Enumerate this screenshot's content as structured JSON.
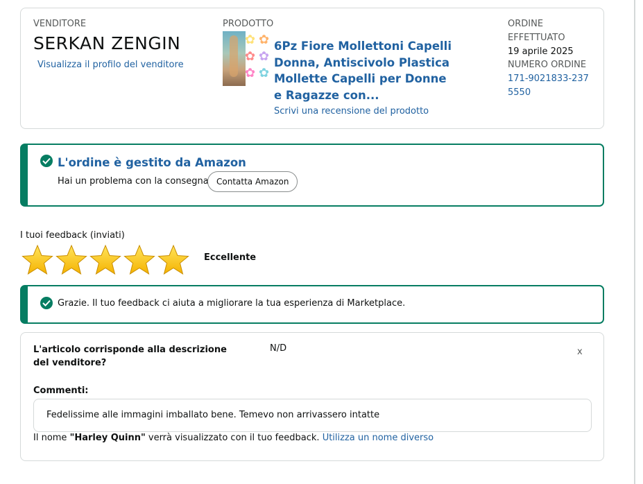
{
  "seller": {
    "label": "VENDITORE",
    "name": "SERKAN ZENGIN",
    "profile_link": "Visualizza il profilo del venditore"
  },
  "product": {
    "label": "PRODOTTO",
    "title": "6Pz Fiore Mollettoni Capelli Donna, Antiscivolo Plastica Mollette Capelli per Donne e Ragazze con...",
    "review_link": "Scrivi una recensione del prodotto"
  },
  "order": {
    "placed_label": "ORDINE EFFETTUATO",
    "placed_date": "19 aprile 2025",
    "number_label": "NUMERO ORDINE",
    "number": "171-9021833-2375550"
  },
  "fulfillment_alert": {
    "heading": "L'ordine è gestito da Amazon",
    "text": "Hai un problema con la consegna?",
    "button": "Contatta Amazon"
  },
  "feedback": {
    "label": "I tuoi feedback (inviati)",
    "rating": 5,
    "max_rating": 5,
    "rating_text": "Eccellente",
    "star_color": "#f5b301"
  },
  "thanks_alert": {
    "text": "Grazie. Il tuo feedback ci aiuta a migliorare la tua esperienza di Marketplace."
  },
  "details": {
    "question": "L'articolo corrisponde alla descrizione del venditore?",
    "answer": "N/D",
    "close": "x",
    "comments_label": "Commenti:",
    "comment": "Fedelissime alle immagini imballato bene. Temevo non arrivassero intatte",
    "name_prefix": "Il nome",
    "display_name": "\"Harley Quinn\"",
    "name_suffix": "verrà visualizzato con il tuo feedback.",
    "change_name_link": "Utilizza un nome diverso"
  },
  "colors": {
    "link": "#2162a1",
    "success": "#067d62",
    "border": "#d5d9d9"
  }
}
